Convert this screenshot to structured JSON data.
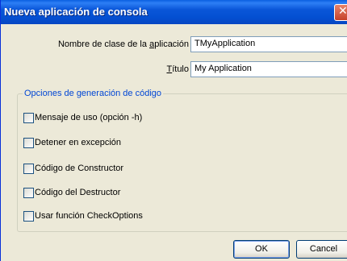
{
  "window": {
    "title": "Nueva aplicación de consola",
    "close_glyph": "✕"
  },
  "fields": {
    "class_name": {
      "label_before": "Nombre de clase de la ",
      "label_accel": "a",
      "label_after": "plicación",
      "value": "TMyApplication"
    },
    "title": {
      "label_accel": "T",
      "label_after": "ítulo",
      "value": "My Application"
    }
  },
  "options": {
    "legend": "Opciones de generación de código",
    "items": [
      {
        "label": "Mensaje de uso (opción -h)",
        "checked": false
      },
      {
        "label": "Detener en excepción",
        "checked": false
      },
      {
        "label": "Código de Constructor",
        "checked": false
      },
      {
        "label": "Código del Destructor",
        "checked": false
      },
      {
        "label": "Usar función CheckOptions",
        "checked": false
      }
    ]
  },
  "buttons": {
    "ok": "OK",
    "cancel": "Cancel"
  },
  "icons": {
    "close": "close-icon"
  }
}
